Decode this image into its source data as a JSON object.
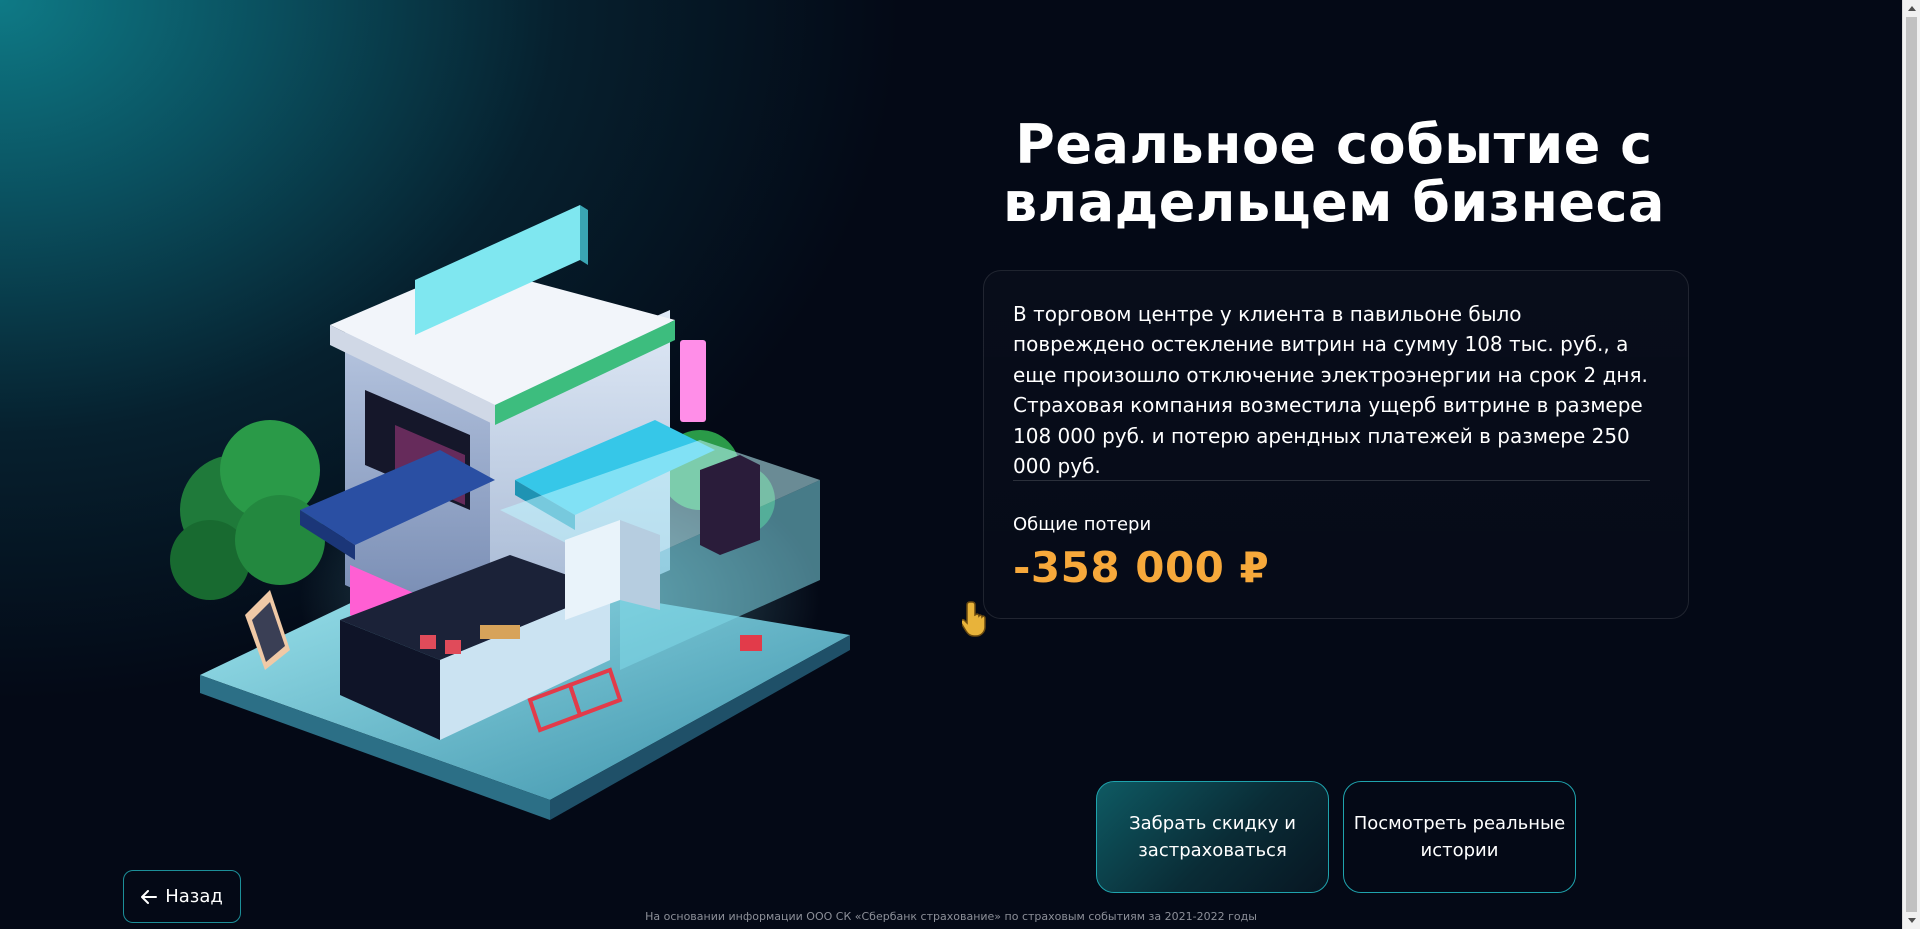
{
  "title": "Реальное событие с владельцем бизнеса",
  "card": {
    "description": "В торговом центре у клиента в павильоне было повреждено остекление витрин на сумму 108 тыс. руб., а еще произошло отключение электроэнергии на срок 2 дня. Страховая компания возместила ущерб витрине в размере 108 000 руб. и потерю арендных платежей в размере 250 000 руб.",
    "loss_label": "Общие потери",
    "loss_value": "-358 000 ₽"
  },
  "buttons": {
    "primary": "Забрать скидку и застраховаться",
    "secondary": "Посмотреть реальные истории"
  },
  "back": {
    "label": "Назад",
    "icon": "arrow-left-icon"
  },
  "footer": "На основании информации ООО СК «Сбербанк страхование» по страховым событиям за 2021-2022 годы",
  "colors": {
    "accent": "#f7a93b",
    "border": "#1fa3ad",
    "background": "#040916"
  }
}
